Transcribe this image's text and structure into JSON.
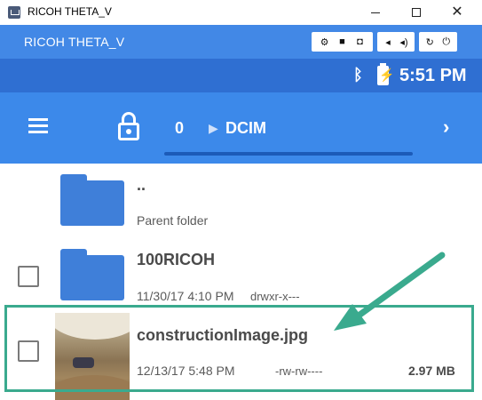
{
  "window": {
    "title": "RICOH THETA_V",
    "close_glyph": "✕"
  },
  "emulator": {
    "title": "RICOH THETA_V",
    "buttons": {
      "settings": "⚙",
      "video": "■",
      "camera": "◘",
      "vol_down": "◂",
      "vol_up": "◂)",
      "rotate": "↻",
      "power": "⏻"
    }
  },
  "status_bar": {
    "bluetooth_icon": "bluetooth-icon",
    "battery_icon": "battery-charging-icon",
    "bluetooth_glyph": "ᛒ",
    "bolt_glyph": "⚡",
    "time": "5:51 PM"
  },
  "app_bar": {
    "breadcrumb_root": "0",
    "breadcrumb_separator": "▶",
    "breadcrumb_current": "DCIM",
    "next_glyph": "›"
  },
  "files": [
    {
      "name": "..",
      "subtitle": "Parent folder",
      "type": "folder"
    },
    {
      "name": "100RICOH",
      "date": "11/30/17 4:10 PM",
      "permissions": "drwxr-x---",
      "type": "folder"
    },
    {
      "name": "constructionImage.jpg",
      "date": "12/13/17 5:48 PM",
      "permissions": "-rw-rw----",
      "size": "2.97 MB",
      "type": "image"
    }
  ],
  "colors": {
    "emulator_header": "#4288e6",
    "status_bar": "#2f6fd2",
    "app_bar": "#3c89ea",
    "folder": "#3f7fd9",
    "annotation": "#3aaa8e"
  }
}
